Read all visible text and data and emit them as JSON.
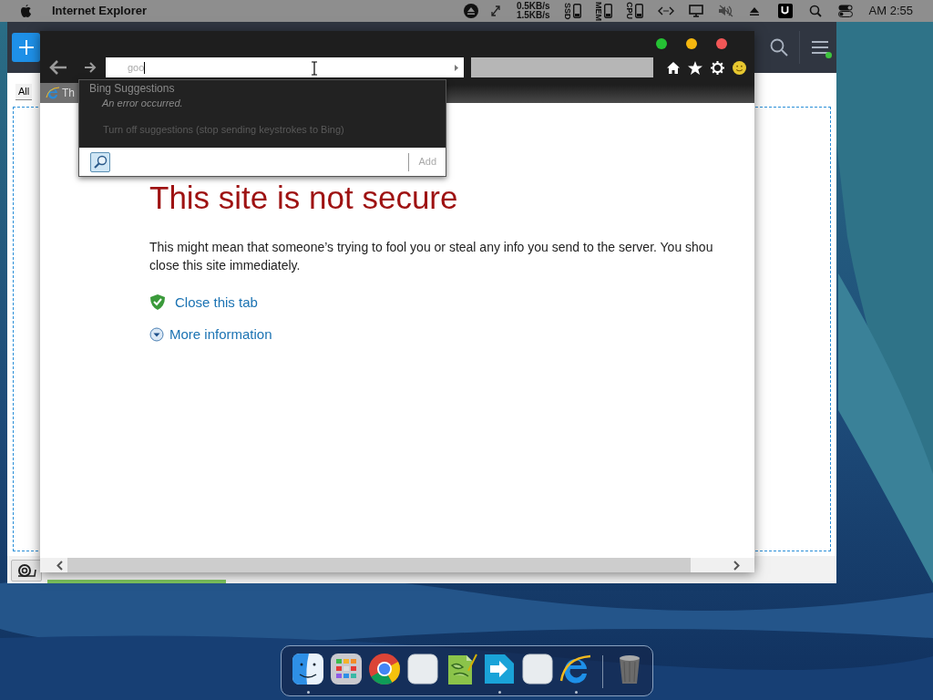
{
  "menu_bar": {
    "app_name": "Internet Explorer",
    "net_up": "0.5KB/s",
    "net_down": "1.5KB/s",
    "meters": [
      "SSD",
      "MEM",
      "CPU"
    ],
    "clock": "AM 2:55"
  },
  "back_window": {
    "tab": "All"
  },
  "browser": {
    "address": {
      "value": "goo"
    },
    "tab": {
      "title": "Th"
    },
    "suggestions": {
      "header": "Bing Suggestions",
      "error": "An error occurred.",
      "turn_off": "Turn off suggestions (stop sending keystrokes to Bing)",
      "add_button": "Add"
    },
    "page": {
      "title": "This site is not secure",
      "message": "This might mean that someone’s trying to fool you or steal any info you send to the server. You shou",
      "message_2": "close this site immediately.",
      "links": [
        {
          "kind": "close",
          "label": "Close this tab"
        },
        {
          "kind": "more",
          "label": "More information"
        }
      ]
    }
  },
  "dock": {
    "apps": [
      {
        "kind": "finder",
        "running": true
      },
      {
        "kind": "launchpad",
        "running": false
      },
      {
        "kind": "chrome",
        "running": false
      },
      {
        "kind": "blank",
        "running": false
      },
      {
        "kind": "notepad",
        "running": false
      },
      {
        "kind": "arrow",
        "running": true
      },
      {
        "kind": "blank",
        "running": false
      },
      {
        "kind": "ie",
        "running": true
      },
      {
        "kind": "trash",
        "running": false
      }
    ]
  }
}
